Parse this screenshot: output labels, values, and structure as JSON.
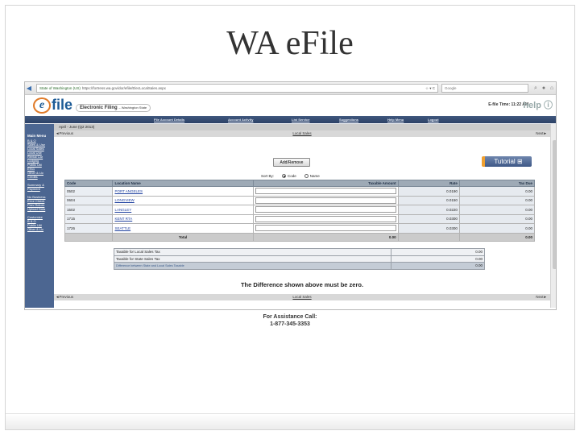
{
  "slide": {
    "title": "WA eFile"
  },
  "browser": {
    "url_site": "State of Washington (US)",
    "url": "https://fortress.wa.gov/dor/efile/ElecLocalSales.aspx",
    "search_placeholder": "Google"
  },
  "header": {
    "logo_e": "e",
    "logo_file": "file",
    "logo_sub": "Electronic Filing",
    "logo_state": "– Washington State",
    "time": "E-file Time: 11:22 AM",
    "help": "help"
  },
  "nav": [
    "File Account Details",
    "Account Activity",
    "List Service",
    "Suggestions",
    "Help Menu",
    "Logout"
  ],
  "sidebar": {
    "head": "Main Menu",
    "group1": [
      "B & O",
      "Sales & Use",
      "Local Sales",
      "Local Use",
      "Rental Car",
      "Lodging",
      "Public Util",
      "E911",
      "Other & Lic",
      "Credits"
    ],
    "group2": [
      "Summary &",
      "Payment"
    ],
    "group3": [
      "No Business",
      "Error Check",
      "Prev Return",
      "Upload Data"
    ],
    "group4": [
      "Customize",
      "B & O",
      "Public Util",
      "Other & Lic"
    ]
  },
  "period": "April - June (Q2 2013)",
  "pager": {
    "prev": "◄Previous",
    "title": "Local Sales",
    "next": "Next►"
  },
  "actions": {
    "add_remove": "Add/Remove",
    "tutorial": "Tutorial"
  },
  "sort": {
    "label": "Sort By:",
    "option_code": "Code",
    "option_name": "Name"
  },
  "table": {
    "headers": [
      "Code",
      "Location Name",
      "Taxable Amount",
      "Rate",
      "Tax Due"
    ],
    "rows": [
      {
        "code": "0502",
        "name": "PORT ANGELES",
        "rate": "0.0190",
        "due": "0.00"
      },
      {
        "code": "0604",
        "name": "LONGVIEW",
        "rate": "0.0150",
        "due": "0.00"
      },
      {
        "code": "1502",
        "name": "LANGLEY",
        "rate": "0.0220",
        "due": "0.00"
      },
      {
        "code": "1715",
        "name": "KENT RTA",
        "rate": "0.0300",
        "due": "0.00"
      },
      {
        "code": "1726",
        "name": "SEATTLE",
        "rate": "0.0300",
        "due": "0.00"
      }
    ],
    "total_label": "Total",
    "total_taxable": "0.00",
    "total_due": "0.00"
  },
  "summary": {
    "local_label": "Taxable for Local Sales Tax",
    "local_value": "0.00",
    "state_label": "Taxable for State Sales Tax",
    "state_value": "0.00",
    "diff_label": "Difference between State and Local Sales Taxable",
    "diff_value": "0.00"
  },
  "notice": "The Difference shown above must be zero.",
  "assistance": {
    "line1": "For Assistance Call:",
    "line2": "1-877-345-3353"
  }
}
